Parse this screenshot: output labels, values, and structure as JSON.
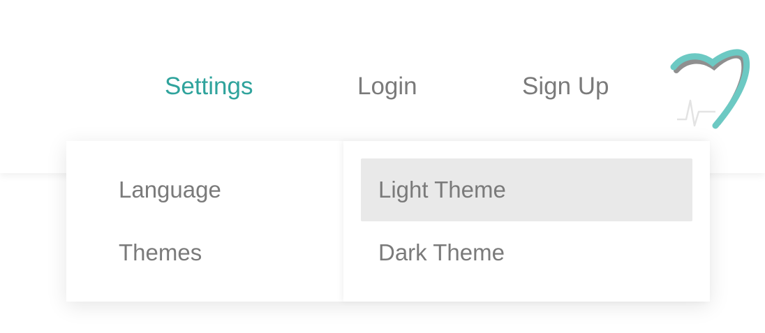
{
  "nav": {
    "settings_label": "Settings",
    "login_label": "Login",
    "signup_label": "Sign Up",
    "active_item": "Settings"
  },
  "logo": {
    "icon": "heart-heartbeat-logo",
    "colors": {
      "teal": "#6cc9c3",
      "gray": "#8f8f8f",
      "pulse": "#e3e3e3"
    }
  },
  "settings_menu": {
    "items": [
      {
        "label": "Language"
      },
      {
        "label": "Themes"
      }
    ]
  },
  "themes_submenu": {
    "options": [
      {
        "label": "Light Theme",
        "highlighted": true
      },
      {
        "label": "Dark Theme",
        "highlighted": false
      }
    ]
  },
  "colors": {
    "accent": "#2fa39c",
    "text": "#7a7a7a",
    "highlight_bg": "#e9e9e9",
    "background": "#ffffff"
  }
}
